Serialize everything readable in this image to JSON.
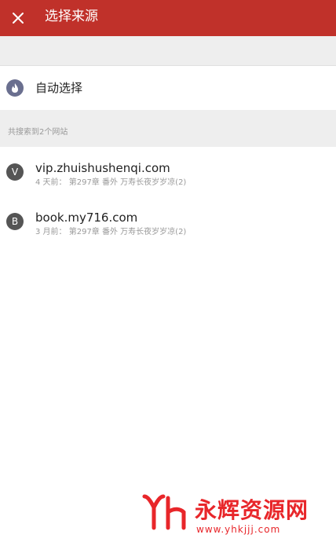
{
  "header": {
    "title": "选择来源",
    "close_icon": "close-icon"
  },
  "auto_select": {
    "label": "自动选择",
    "icon": "flame-icon"
  },
  "section": {
    "label": "共搜索到2个网站"
  },
  "sources": [
    {
      "avatar_letter": "V",
      "name": "vip.zhuishushenqi.com",
      "subtitle": "4 天前： 第297章 番外 万寿长夜岁岁凉(2)"
    },
    {
      "avatar_letter": "B",
      "name": "book.my716.com",
      "subtitle": "3 月前： 第297章 番外 万寿长夜岁岁凉(2)"
    }
  ],
  "watermark": {
    "logo": "YH",
    "text": "永辉资源网",
    "url": "www.yhkjjj.com"
  },
  "colors": {
    "header_bg": "#c0312a",
    "accent_red": "#e8262a",
    "gray_bg": "#eeeeee",
    "auto_icon_bg": "#6a6f8f"
  }
}
